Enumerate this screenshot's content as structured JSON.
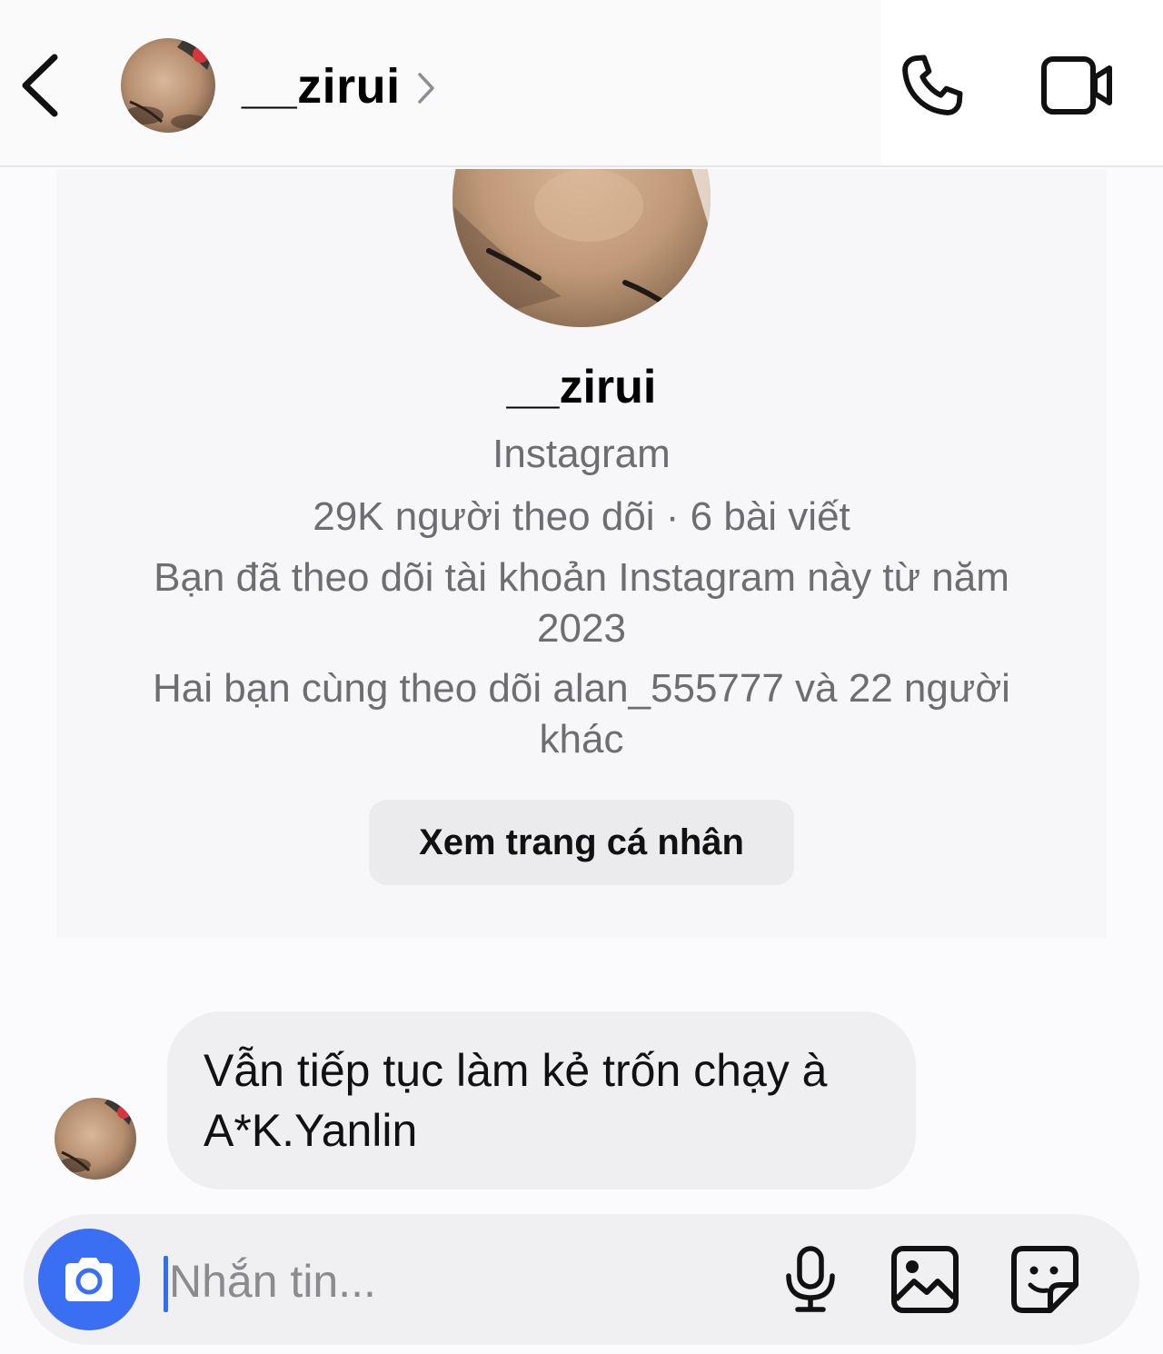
{
  "header": {
    "username": "__zirui",
    "icons": {
      "back": "chevron-left-icon",
      "more": "chevron-right-icon",
      "call": "phone-icon",
      "video": "video-camera-icon"
    }
  },
  "profile": {
    "username": "__zirui",
    "platform": "Instagram",
    "stats": "29K người theo dõi · 6 bài viết",
    "follow_since": "Bạn đã theo dõi tài khoản Instagram này từ năm 2023",
    "mutual": "Hai bạn cùng theo dõi alan_555777 và 22 người khác",
    "view_profile_label": "Xem trang cá nhân"
  },
  "messages": [
    {
      "text": "Vẫn tiếp tục làm kẻ trốn chạy à A*K.Yanlin",
      "sender": "__zirui"
    }
  ],
  "composer": {
    "value": "",
    "placeholder": "Nhắn tin...",
    "icons": {
      "camera": "camera-icon",
      "mic": "microphone-icon",
      "gallery": "image-icon",
      "sticker": "sticker-icon"
    }
  },
  "colors": {
    "accent": "#3a6ff3",
    "secondary_text": "#6d6d72",
    "bubble": "#efeff2"
  }
}
